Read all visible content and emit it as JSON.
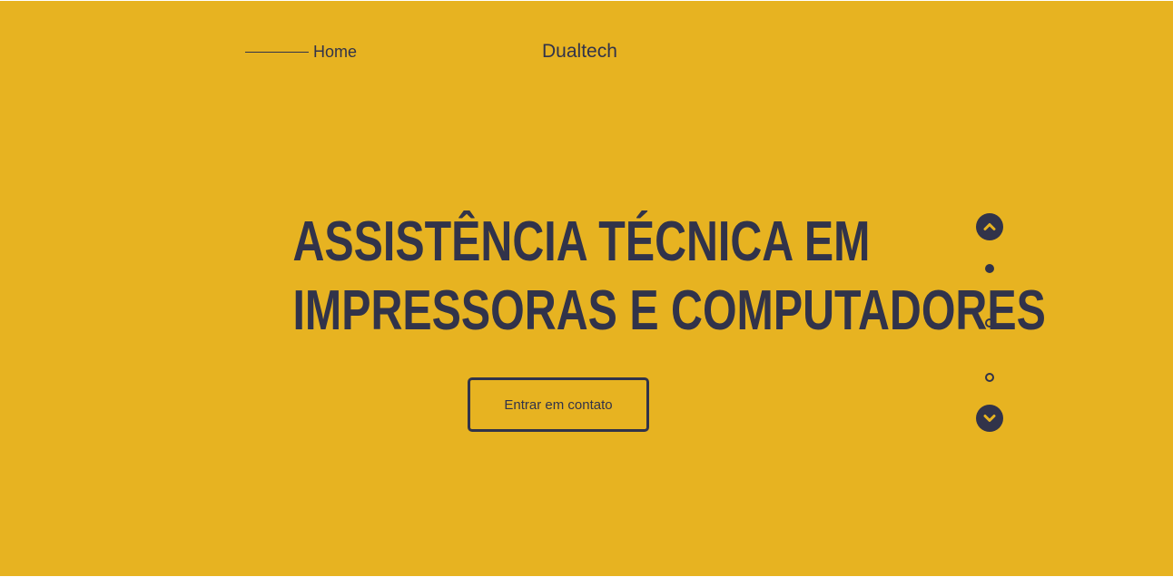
{
  "nav": {
    "home_label": "Home",
    "brand": "Dualtech"
  },
  "hero": {
    "title_line1": "ASSISTÊNCIA TÉCNICA EM",
    "title_line2": "IMPRESSORAS E COMPUTADORES",
    "cta_label": "Entrar em contato"
  },
  "pager": {
    "up_icon": "chevron-up-icon",
    "down_icon": "chevron-down-icon",
    "slides": [
      {
        "active": true
      },
      {
        "active": false
      },
      {
        "active": false
      }
    ]
  },
  "colors": {
    "background": "#e7b321",
    "text": "#31334a"
  }
}
